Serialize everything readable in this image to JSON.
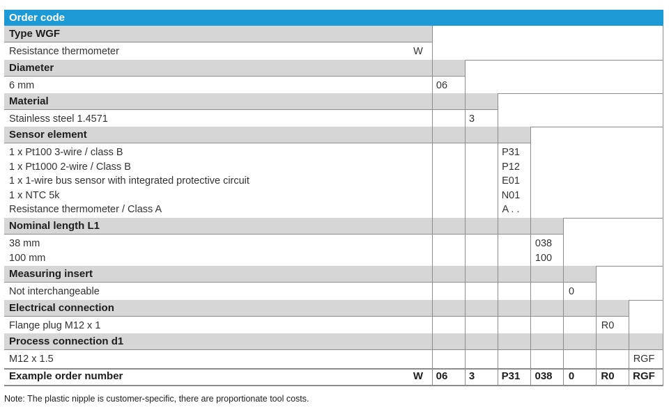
{
  "title": "Order code",
  "sections": [
    {
      "header": "Type WGF",
      "rows": [
        {
          "label": "Resistance thermometer",
          "code": "W"
        }
      ]
    },
    {
      "header": "Diameter",
      "rows": [
        {
          "label": "6 mm",
          "code": "06"
        }
      ]
    },
    {
      "header": "Material",
      "rows": [
        {
          "label": "Stainless steel 1.4571",
          "code": "3"
        }
      ]
    },
    {
      "header": "Sensor element",
      "rows": [
        {
          "label": "1 x Pt100 3-wire / class B",
          "code": "P31"
        },
        {
          "label": "1 x Pt1000 2-wire / Class B",
          "code": "P12"
        },
        {
          "label": "1 x 1-wire bus sensor with integrated protective circuit",
          "code": "E01"
        },
        {
          "label": "1 x NTC 5k",
          "code": "N01"
        },
        {
          "label": "Resistance thermometer / Class A",
          "code": "A . ."
        }
      ]
    },
    {
      "header": "Nominal length L1",
      "rows": [
        {
          "label": "38 mm",
          "code": "038"
        },
        {
          "label": "100 mm",
          "code": "100"
        }
      ]
    },
    {
      "header": "Measuring insert",
      "rows": [
        {
          "label": "Not interchangeable",
          "code": "0"
        }
      ]
    },
    {
      "header": "Electrical connection",
      "rows": [
        {
          "label": "Flange plug M12 x 1",
          "code": "R0"
        }
      ]
    },
    {
      "header": "Process connection d1",
      "rows": [
        {
          "label": "M12 x 1.5",
          "code": "RGF"
        }
      ]
    }
  ],
  "example": {
    "label": "Example order number",
    "codes": [
      "W",
      "06",
      "3",
      "P31",
      "038",
      "0",
      "R0",
      "RGF"
    ]
  },
  "note": "Note: The plastic nipple is customer-specific, there are proportionate tool costs.",
  "colors": {
    "title_bar": "#1c9ad6",
    "header_bg": "#d6d6d6",
    "rule": "#8c8c8c"
  }
}
